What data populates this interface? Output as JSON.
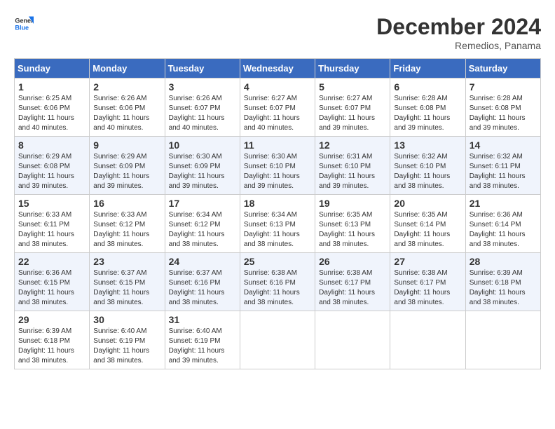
{
  "header": {
    "logo_general": "General",
    "logo_blue": "Blue",
    "month_title": "December 2024",
    "location": "Remedios, Panama"
  },
  "days_of_week": [
    "Sunday",
    "Monday",
    "Tuesday",
    "Wednesday",
    "Thursday",
    "Friday",
    "Saturday"
  ],
  "weeks": [
    [
      {
        "day": "1",
        "sunrise": "6:25 AM",
        "sunset": "6:06 PM",
        "daylight": "11 hours and 40 minutes."
      },
      {
        "day": "2",
        "sunrise": "6:26 AM",
        "sunset": "6:06 PM",
        "daylight": "11 hours and 40 minutes."
      },
      {
        "day": "3",
        "sunrise": "6:26 AM",
        "sunset": "6:07 PM",
        "daylight": "11 hours and 40 minutes."
      },
      {
        "day": "4",
        "sunrise": "6:27 AM",
        "sunset": "6:07 PM",
        "daylight": "11 hours and 40 minutes."
      },
      {
        "day": "5",
        "sunrise": "6:27 AM",
        "sunset": "6:07 PM",
        "daylight": "11 hours and 39 minutes."
      },
      {
        "day": "6",
        "sunrise": "6:28 AM",
        "sunset": "6:08 PM",
        "daylight": "11 hours and 39 minutes."
      },
      {
        "day": "7",
        "sunrise": "6:28 AM",
        "sunset": "6:08 PM",
        "daylight": "11 hours and 39 minutes."
      }
    ],
    [
      {
        "day": "8",
        "sunrise": "6:29 AM",
        "sunset": "6:08 PM",
        "daylight": "11 hours and 39 minutes."
      },
      {
        "day": "9",
        "sunrise": "6:29 AM",
        "sunset": "6:09 PM",
        "daylight": "11 hours and 39 minutes."
      },
      {
        "day": "10",
        "sunrise": "6:30 AM",
        "sunset": "6:09 PM",
        "daylight": "11 hours and 39 minutes."
      },
      {
        "day": "11",
        "sunrise": "6:30 AM",
        "sunset": "6:10 PM",
        "daylight": "11 hours and 39 minutes."
      },
      {
        "day": "12",
        "sunrise": "6:31 AM",
        "sunset": "6:10 PM",
        "daylight": "11 hours and 39 minutes."
      },
      {
        "day": "13",
        "sunrise": "6:32 AM",
        "sunset": "6:10 PM",
        "daylight": "11 hours and 38 minutes."
      },
      {
        "day": "14",
        "sunrise": "6:32 AM",
        "sunset": "6:11 PM",
        "daylight": "11 hours and 38 minutes."
      }
    ],
    [
      {
        "day": "15",
        "sunrise": "6:33 AM",
        "sunset": "6:11 PM",
        "daylight": "11 hours and 38 minutes."
      },
      {
        "day": "16",
        "sunrise": "6:33 AM",
        "sunset": "6:12 PM",
        "daylight": "11 hours and 38 minutes."
      },
      {
        "day": "17",
        "sunrise": "6:34 AM",
        "sunset": "6:12 PM",
        "daylight": "11 hours and 38 minutes."
      },
      {
        "day": "18",
        "sunrise": "6:34 AM",
        "sunset": "6:13 PM",
        "daylight": "11 hours and 38 minutes."
      },
      {
        "day": "19",
        "sunrise": "6:35 AM",
        "sunset": "6:13 PM",
        "daylight": "11 hours and 38 minutes."
      },
      {
        "day": "20",
        "sunrise": "6:35 AM",
        "sunset": "6:14 PM",
        "daylight": "11 hours and 38 minutes."
      },
      {
        "day": "21",
        "sunrise": "6:36 AM",
        "sunset": "6:14 PM",
        "daylight": "11 hours and 38 minutes."
      }
    ],
    [
      {
        "day": "22",
        "sunrise": "6:36 AM",
        "sunset": "6:15 PM",
        "daylight": "11 hours and 38 minutes."
      },
      {
        "day": "23",
        "sunrise": "6:37 AM",
        "sunset": "6:15 PM",
        "daylight": "11 hours and 38 minutes."
      },
      {
        "day": "24",
        "sunrise": "6:37 AM",
        "sunset": "6:16 PM",
        "daylight": "11 hours and 38 minutes."
      },
      {
        "day": "25",
        "sunrise": "6:38 AM",
        "sunset": "6:16 PM",
        "daylight": "11 hours and 38 minutes."
      },
      {
        "day": "26",
        "sunrise": "6:38 AM",
        "sunset": "6:17 PM",
        "daylight": "11 hours and 38 minutes."
      },
      {
        "day": "27",
        "sunrise": "6:38 AM",
        "sunset": "6:17 PM",
        "daylight": "11 hours and 38 minutes."
      },
      {
        "day": "28",
        "sunrise": "6:39 AM",
        "sunset": "6:18 PM",
        "daylight": "11 hours and 38 minutes."
      }
    ],
    [
      {
        "day": "29",
        "sunrise": "6:39 AM",
        "sunset": "6:18 PM",
        "daylight": "11 hours and 38 minutes."
      },
      {
        "day": "30",
        "sunrise": "6:40 AM",
        "sunset": "6:19 PM",
        "daylight": "11 hours and 38 minutes."
      },
      {
        "day": "31",
        "sunrise": "6:40 AM",
        "sunset": "6:19 PM",
        "daylight": "11 hours and 39 minutes."
      },
      null,
      null,
      null,
      null
    ]
  ]
}
